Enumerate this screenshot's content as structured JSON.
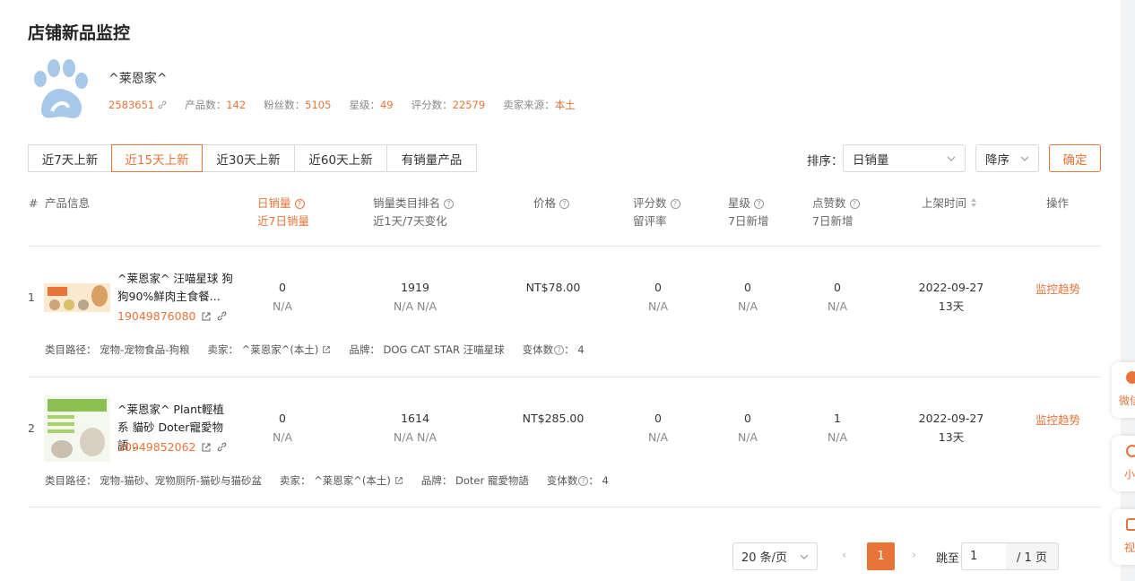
{
  "title": "店铺新品监控",
  "shop": {
    "name": "^莱恩家^",
    "id": "2583651",
    "stats": [
      {
        "label": "产品数：",
        "value": "142"
      },
      {
        "label": "粉丝数：",
        "value": "5105"
      },
      {
        "label": "星级：",
        "value": "49"
      },
      {
        "label": "评分数：",
        "value": "22579"
      },
      {
        "label": "卖家来源：",
        "value": "本土"
      }
    ]
  },
  "tabs": [
    "近7天上新",
    "近15天上新",
    "近30天上新",
    "近60天上新",
    "有销量产品"
  ],
  "active_tab": 1,
  "sort": {
    "label": "排序：",
    "field": "日销量",
    "order": "降序",
    "confirm": "确定"
  },
  "columns": {
    "num": "#",
    "product": "产品信息",
    "daily_sales": "日销量",
    "sales_7d": "近7日销量",
    "rank": "销量类目排名",
    "rank_sub": "近1天/7天变化",
    "price": "价格",
    "reviews": "评分数",
    "reviews_sub": "留评率",
    "stars": "星级",
    "stars_sub": "7日新增",
    "likes": "点赞数",
    "likes_sub": "7日新增",
    "listed": "上架时间",
    "ops": "操作"
  },
  "rows": [
    {
      "index": "1",
      "name": "^莱恩家^ 汪喵星球 狗狗90%鮮肉主食餐...",
      "pid": "19049876080",
      "daily": "0",
      "daily_sub": "N/A",
      "rank": "1919",
      "rank_sub": "N/A N/A",
      "price": "NT$78.00",
      "reviews": "0",
      "reviews_sub": "N/A",
      "stars": "0",
      "stars_sub": "N/A",
      "likes": "0",
      "likes_sub": "N/A",
      "date": "2022-09-27",
      "days": "13天",
      "op": "监控趋势",
      "category": "类目路径：  宠物-宠物食品-狗粮",
      "seller": "卖家：  ^莱恩家^(本土)",
      "brand": "品牌：  DOG CAT STAR 汪喵星球",
      "variants": "变体数",
      "variants_count": "：  4"
    },
    {
      "index": "2",
      "name": "^莱恩家^ Plant輕植系 貓砂 Doter寵愛物語...",
      "pid": "20949852062",
      "daily": "0",
      "daily_sub": "N/A",
      "rank": "1614",
      "rank_sub": "N/A N/A",
      "price": "NT$285.00",
      "reviews": "0",
      "reviews_sub": "N/A",
      "stars": "0",
      "stars_sub": "N/A",
      "likes": "1",
      "likes_sub": "N/A",
      "date": "2022-09-27",
      "days": "13天",
      "op": "监控趋势",
      "category": "类目路径：  宠物-猫砂、宠物厕所-猫砂与猫砂盆",
      "seller": "卖家：  ^莱恩家^(本土)",
      "brand": "品牌：  Doter 寵愛物語",
      "variants": "变体数",
      "variants_count": "：  4"
    }
  ],
  "float_buttons": [
    "微信",
    "小",
    "视"
  ],
  "pagination": {
    "page_size": "20 条/页",
    "current": "1",
    "jump_label": "跳至",
    "jump_value": "1",
    "total": "/ 1 页"
  },
  "colors": {
    "accent": "#e8743a",
    "paw": "#a8c8ea"
  }
}
